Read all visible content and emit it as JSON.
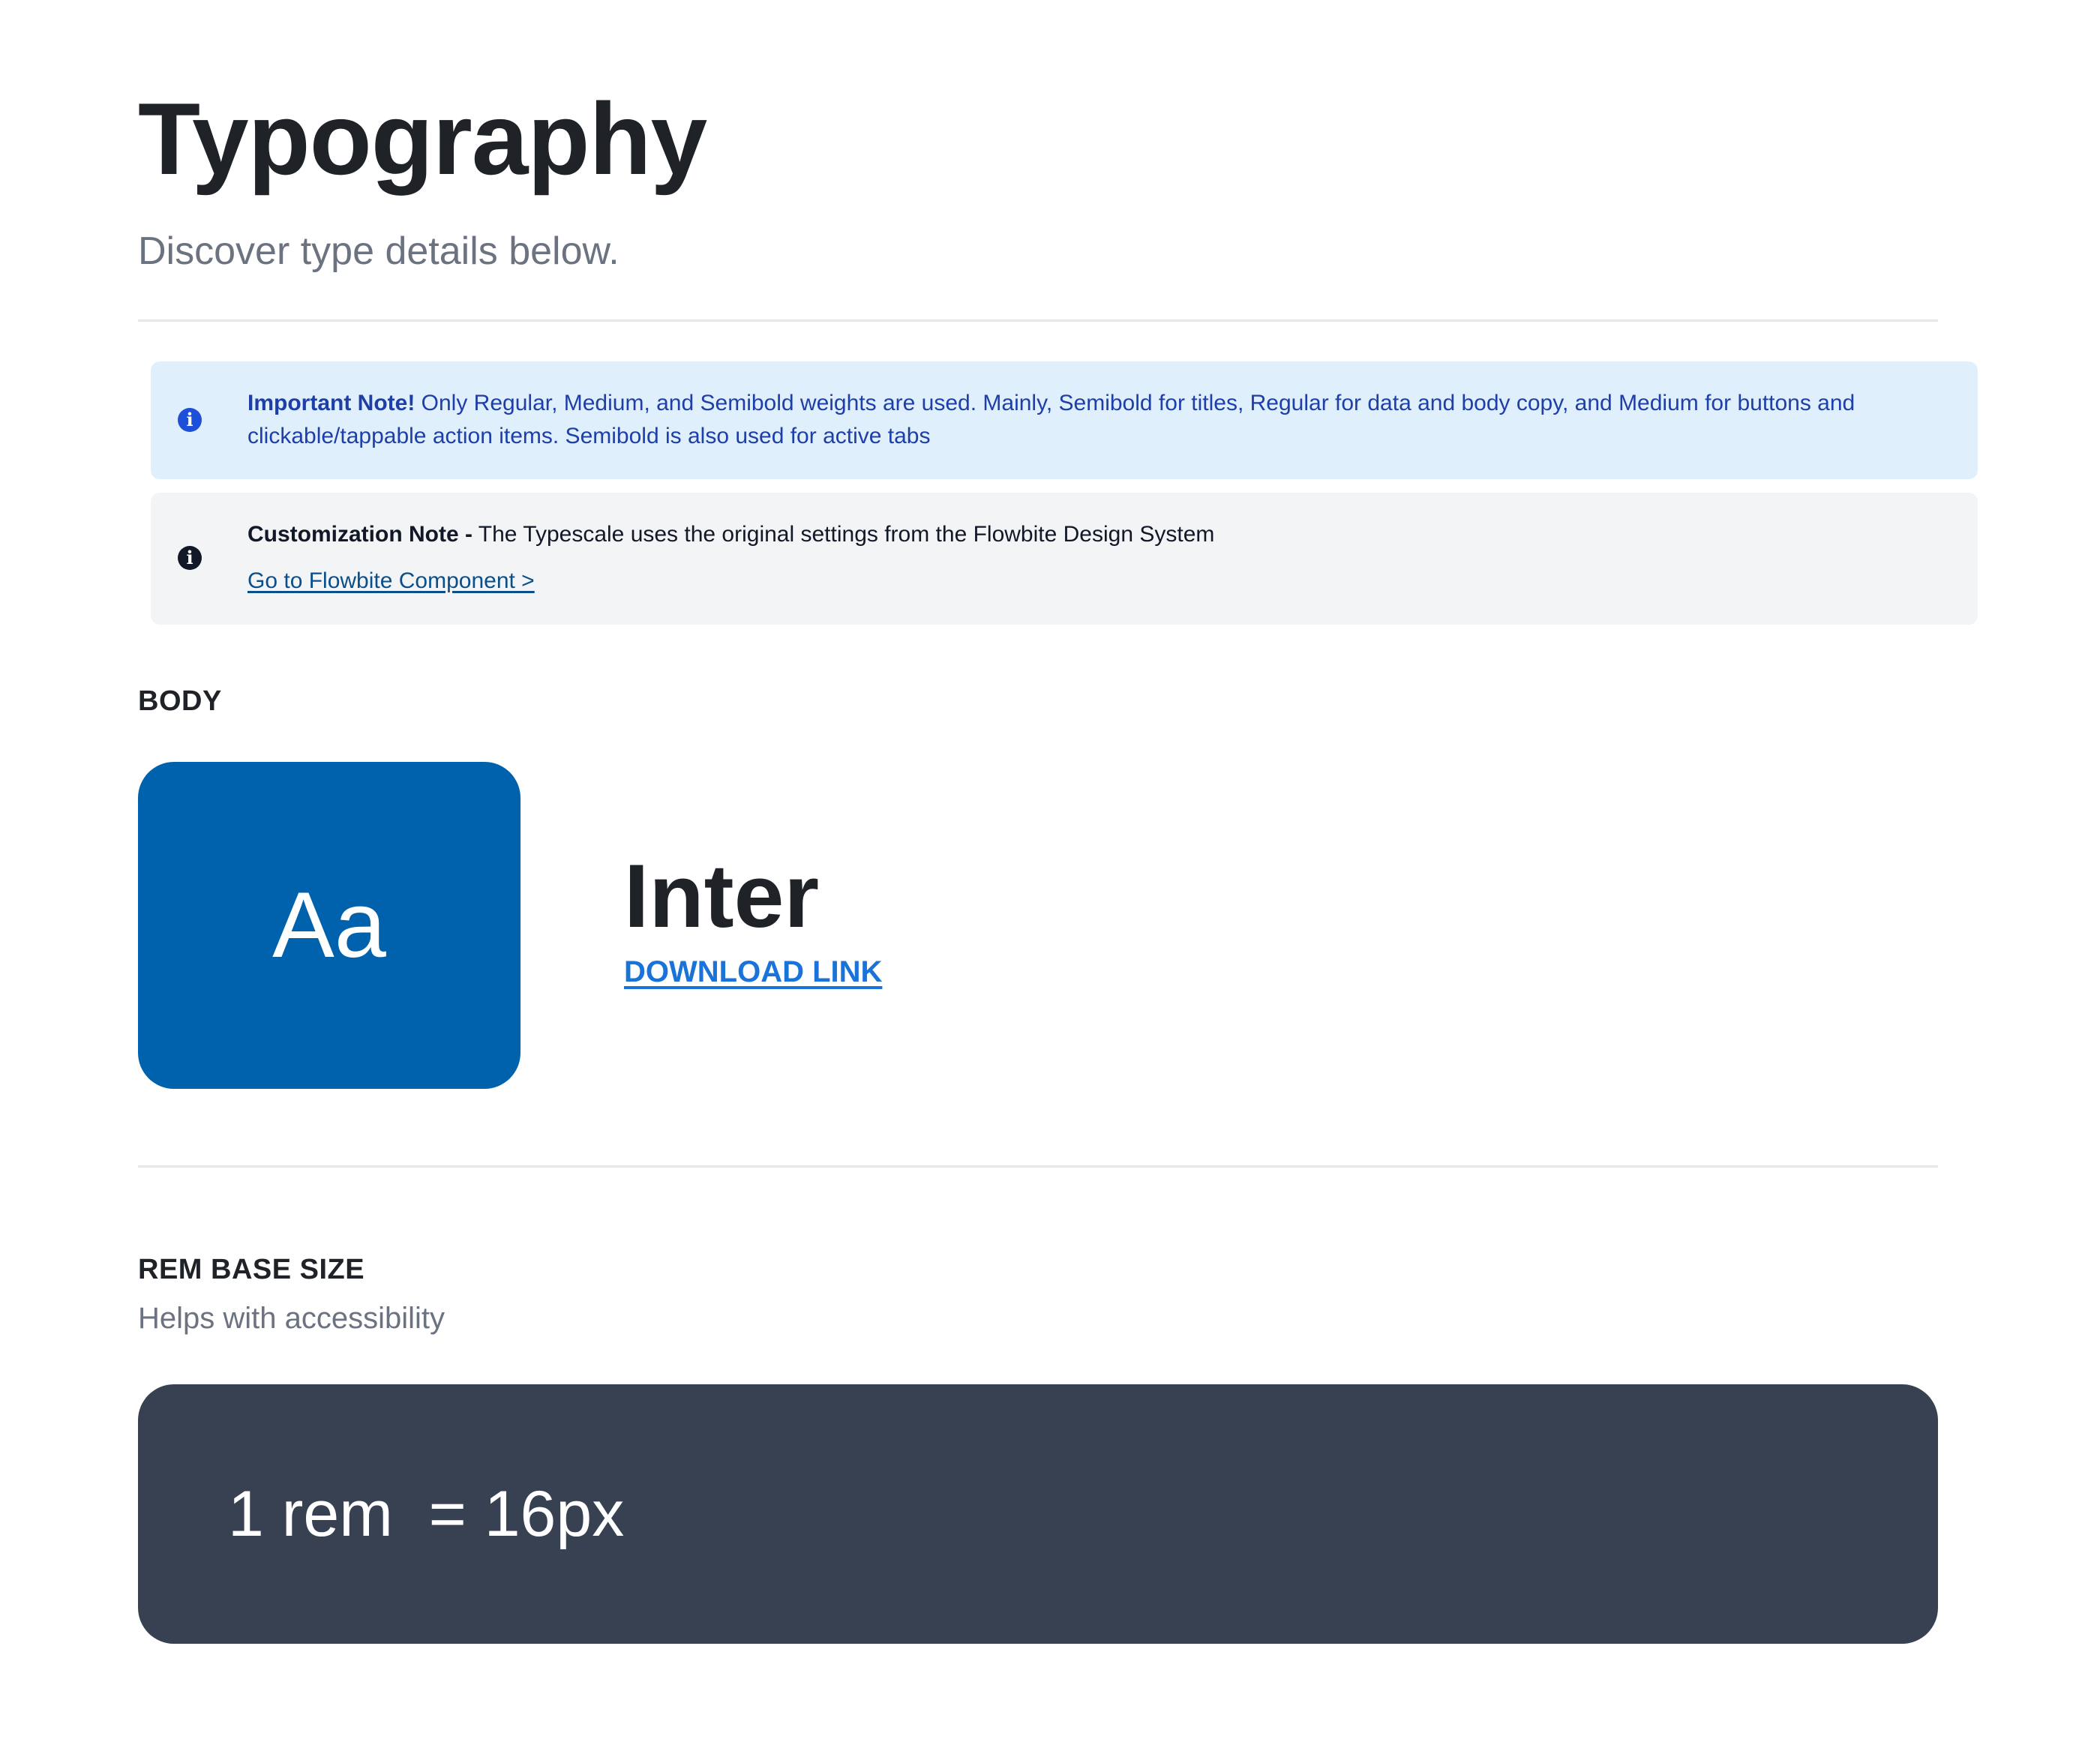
{
  "header": {
    "title": "Typography",
    "subtitle": "Discover type details below."
  },
  "important_note": {
    "icon": "info-icon",
    "label": "Important Note!",
    "text": " Only Regular, Medium, and Semibold weights are used. Mainly, Semibold for titles, Regular for data and body copy, and Medium for buttons and clickable/tappable action items. Semibold is also used for active tabs",
    "background": "#e0effc",
    "text_color": "#1e3ea8"
  },
  "customization_note": {
    "icon": "info-icon",
    "label": "Customization Note -",
    "text": " The Typescale uses the original settings from the Flowbite Design System",
    "link_text": "Go to Flowbite Component >"
  },
  "body_section": {
    "label": "BODY",
    "swatch_text": "Aa",
    "swatch_color": "#0062ad",
    "font_name": "Inter",
    "download_label": "DOWNLOAD LINK"
  },
  "rem_section": {
    "label": "REM BASE SIZE",
    "subtitle": "Helps with accessibility",
    "value": "1 rem  = 16px",
    "box_color": "#384152"
  }
}
